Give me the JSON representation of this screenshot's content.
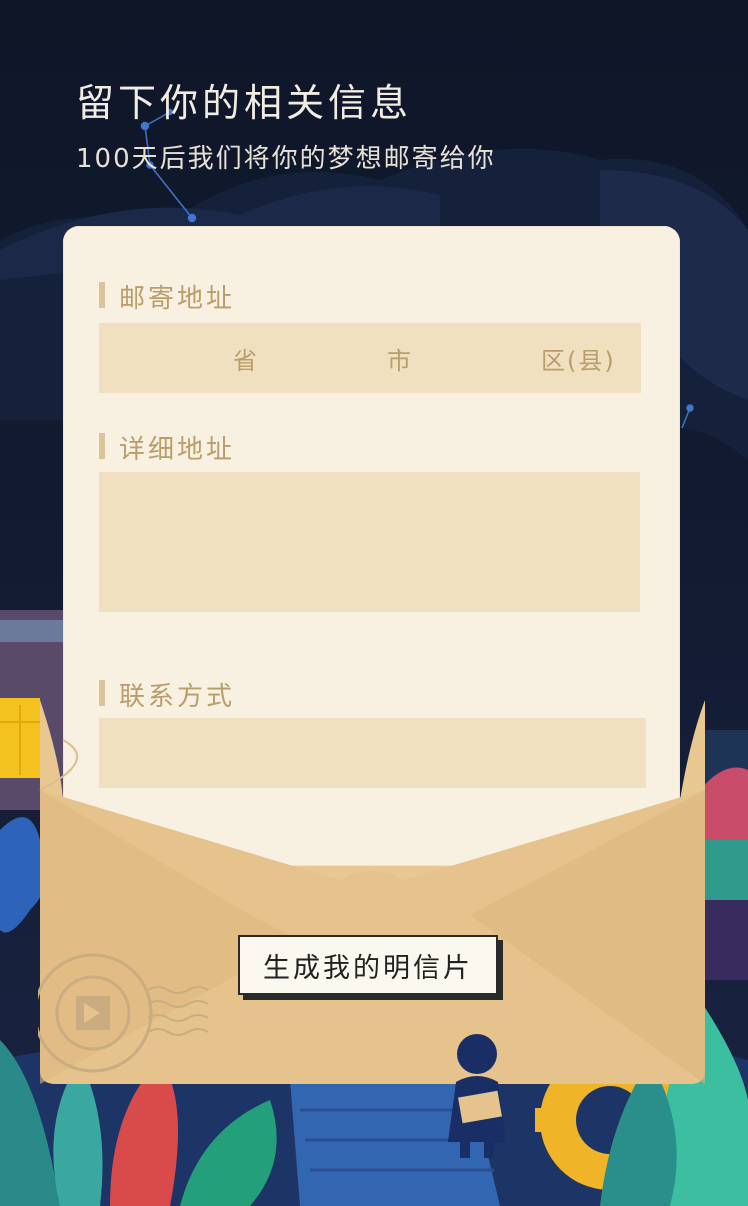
{
  "header": {
    "title": "留下你的相关信息",
    "subtitle": "100天后我们将你的梦想邮寄给你"
  },
  "form": {
    "mailing_address": {
      "label": "邮寄地址",
      "province": "省",
      "city": "市",
      "district": "区(县)"
    },
    "detail_address": {
      "label": "详细地址",
      "value": ""
    },
    "contact": {
      "label": "联系方式",
      "value": ""
    }
  },
  "actions": {
    "generate_label": "生成我的明信片"
  },
  "colors": {
    "sky": "#0f1628",
    "paper": "#f8f1e1",
    "field": "#f1e0bf",
    "label": "#b99d6b",
    "envelope": "#e6c38c",
    "accent_blue": "#3b7bd6"
  },
  "icons": [
    "constellation-icon",
    "stamp-icon",
    "leaf-icon",
    "gear-icon",
    "person-figure-icon"
  ]
}
